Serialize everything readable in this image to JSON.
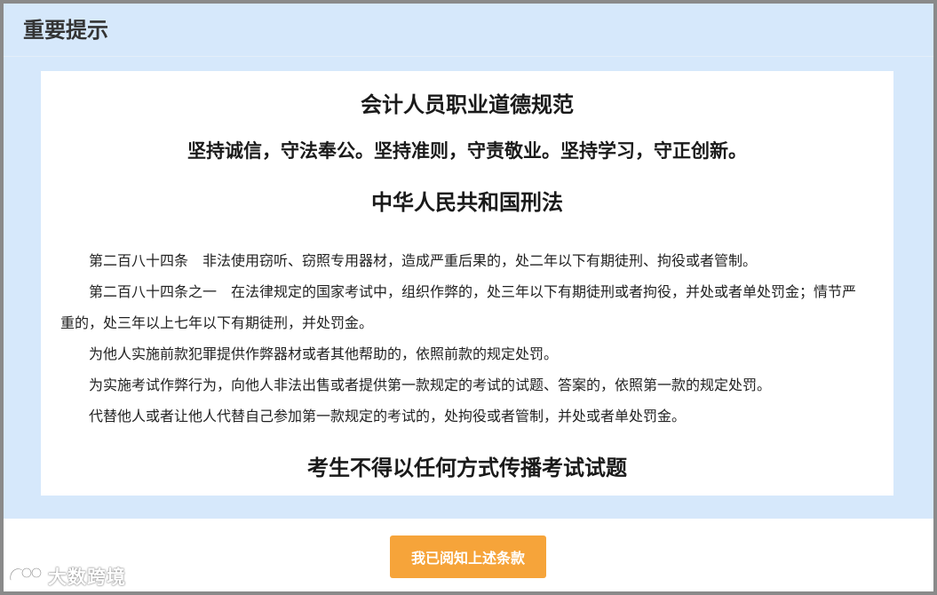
{
  "dialog": {
    "title": "重要提示"
  },
  "content": {
    "code_heading": "会计人员职业道德规范",
    "motto": "坚持诚信，守法奉公。坚持准则，守责敬业。坚持学习，守正创新。",
    "law_heading": "中华人民共和国刑法",
    "paragraphs": [
      "第二百八十四条　非法使用窃听、窃照专用器材，造成严重后果的，处二年以下有期徒刑、拘役或者管制。",
      "第二百八十四条之一　在法律规定的国家考试中，组织作弊的，处三年以下有期徒刑或者拘役，并处或者单处罚金；情节严重的，处三年以上七年以下有期徒刑，并处罚金。",
      "为他人实施前款犯罪提供作弊器材或者其他帮助的，依照前款的规定处罚。",
      "为实施考试作弊行为，向他人非法出售或者提供第一款规定的考试的试题、答案的，依照第一款的规定处罚。",
      "代替他人或者让他人代替自己参加第一款规定的考试的，处拘役或者管制，并处或者单处罚金。"
    ],
    "warning": "考生不得以任何方式传播考试试题"
  },
  "footer": {
    "agree_button_label": "我已阅知上述条款"
  },
  "watermark": {
    "text": "大数跨境",
    "icon": "brand-logo-icon"
  },
  "colors": {
    "dialog_background": "#d6e8fb",
    "button_background": "#f6a43a",
    "button_text": "#ffffff"
  }
}
